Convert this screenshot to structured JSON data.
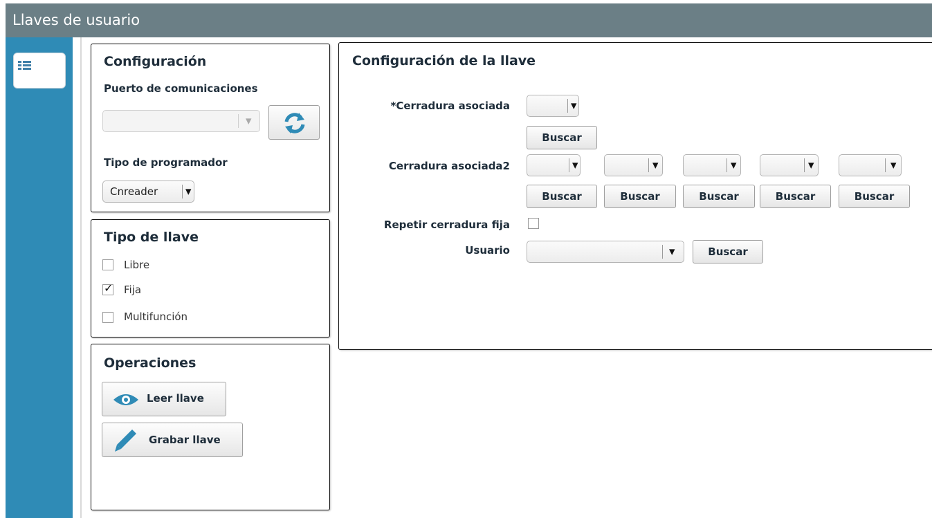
{
  "window": {
    "title": "Llaves de usuario"
  },
  "sidebar": {
    "items": [
      {
        "icon": "list-settings-icon"
      }
    ]
  },
  "config_panel": {
    "title": "Configuración",
    "puerto_label": "Puerto de comunicaciones",
    "puerto_value": "",
    "refresh_icon": "refresh-icon",
    "programador_label": "Tipo de programador",
    "programador_value": "Cnreader"
  },
  "tipo_panel": {
    "title": "Tipo de llave",
    "options": [
      {
        "label": "Libre",
        "checked": false
      },
      {
        "label": "Fija",
        "checked": true
      },
      {
        "label": "Multifunción",
        "checked": false
      }
    ]
  },
  "ops_panel": {
    "title": "Operaciones",
    "leer_label": "Leer llave",
    "leer_icon": "eye-icon",
    "grabar_label": "Grabar llave",
    "grabar_icon": "pencil-icon"
  },
  "main_panel": {
    "title": "Configuración de la llave",
    "cerradura_label": "*Cerradura asociada",
    "cerradura2_label": "Cerradura asociada2",
    "repetir_label": "Repetir cerradura fija",
    "repetir_checked": false,
    "usuario_label": "Usuario",
    "usuario_value": "",
    "buscar_label": "Buscar"
  },
  "colors": {
    "titlebar": "#6b7f86",
    "sidebar": "#2f8bb6",
    "icon_blue": "#2f8bb6"
  }
}
